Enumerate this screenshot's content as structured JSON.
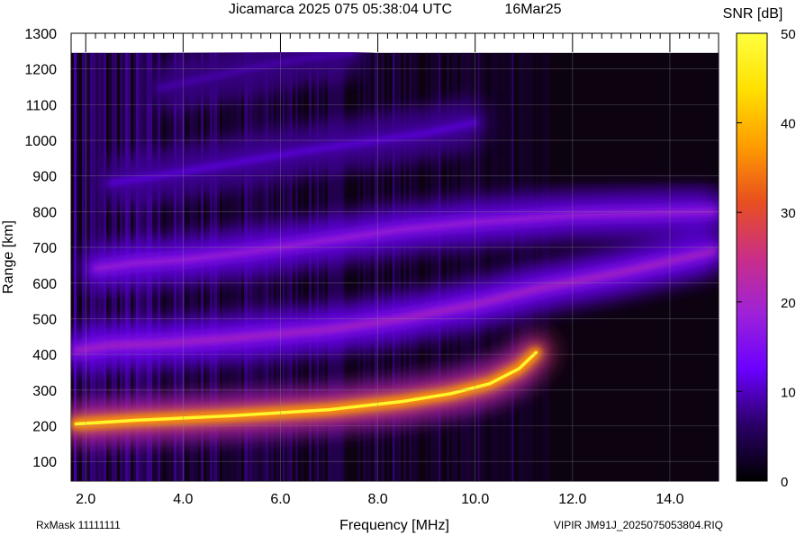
{
  "header": {
    "title": "Jicamarca 2025 075 05:38:04 UTC",
    "date": "16Mar25"
  },
  "footer": {
    "rxmask": "RxMask 11111111",
    "file": "VIPIR  JM91J_2025075053804.RIQ"
  },
  "chart_data": {
    "type": "heatmap",
    "title": "Jicamarca 2025 075 05:38:04 UTC",
    "xlabel": "Frequency [MHz]",
    "ylabel": "Range [km]",
    "xlim": [
      1.7,
      15.0
    ],
    "ylim": [
      45,
      1300
    ],
    "data_ylim": [
      45,
      1245
    ],
    "x_ticks": [
      "2.0",
      "4.0",
      "6.0",
      "8.0",
      "10.0",
      "12.0",
      "14.0"
    ],
    "x_tick_values": [
      2,
      4,
      6,
      8,
      10,
      12,
      14
    ],
    "y_ticks": [
      "100",
      "200",
      "300",
      "400",
      "500",
      "600",
      "700",
      "800",
      "900",
      "1000",
      "1100",
      "1200",
      "1300"
    ],
    "y_tick_values": [
      100,
      200,
      300,
      400,
      500,
      600,
      700,
      800,
      900,
      1000,
      1100,
      1200,
      1300
    ],
    "grid": true,
    "colorbar": {
      "label": "SNR [dB]",
      "range": [
        0,
        50
      ],
      "ticks": [
        "0",
        "10",
        "20",
        "30",
        "40",
        "50"
      ],
      "tick_values": [
        0,
        10,
        20,
        30,
        40,
        50
      ],
      "colors": [
        "#000000",
        "#2a0066",
        "#6b00ff",
        "#9e22d8",
        "#ca2f86",
        "#e8501e",
        "#ff9d00",
        "#ffe000",
        "#ffff40"
      ]
    },
    "traces": [
      {
        "hop": 1,
        "x": [
          1.8,
          3.0,
          5.0,
          7.0,
          8.5,
          9.5,
          10.3,
          10.9,
          11.25
        ],
        "y": [
          205,
          215,
          228,
          245,
          268,
          290,
          318,
          360,
          405
        ],
        "peak_snr_db": 48
      },
      {
        "hop": 2,
        "x": [
          1.8,
          2.5,
          3.5,
          5.0,
          7.0,
          8.5,
          10.0,
          11.3,
          13.0,
          14.9
        ],
        "y": [
          410,
          425,
          430,
          445,
          470,
          500,
          540,
          585,
          630,
          690
        ],
        "peak_snr_db": 22
      },
      {
        "hop": 3,
        "x": [
          2.2,
          3.0,
          4.0,
          5.5,
          7.0,
          8.5,
          10.0,
          12.0,
          14.9
        ],
        "y": [
          640,
          655,
          665,
          690,
          720,
          750,
          770,
          790,
          800
        ],
        "peak_snr_db": 20
      },
      {
        "hop": 4,
        "x": [
          2.5,
          3.5,
          5.0,
          6.5,
          8.0,
          9.0,
          10.0
        ],
        "y": [
          880,
          900,
          935,
          970,
          1000,
          1020,
          1050
        ],
        "peak_snr_db": 12
      },
      {
        "hop": 5,
        "x": [
          3.5,
          4.5,
          5.5,
          6.5,
          7.5
        ],
        "y": [
          1145,
          1175,
          1205,
          1230,
          1245
        ],
        "peak_snr_db": 10
      }
    ]
  }
}
